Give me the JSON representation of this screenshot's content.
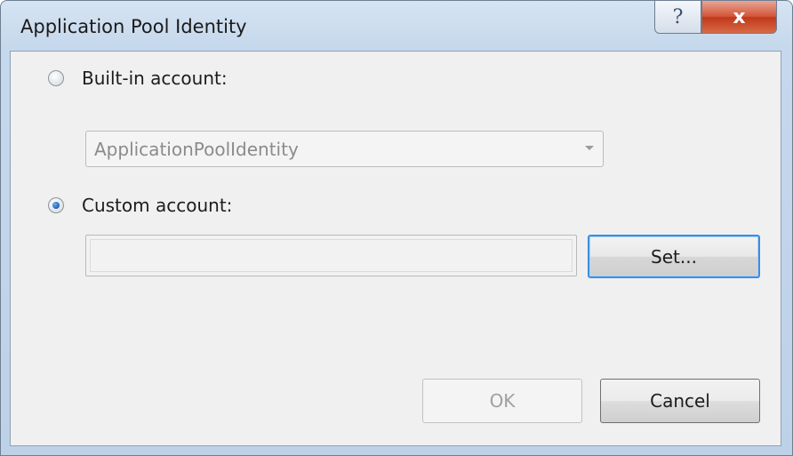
{
  "dialog": {
    "title": "Application Pool Identity",
    "help_glyph": "?",
    "close_glyph": "x"
  },
  "identity": {
    "builtin_label": "Built-in account:",
    "builtin_selected_value": "ApplicationPoolIdentity",
    "custom_label": "Custom account:",
    "custom_value": "",
    "selected_option": "custom",
    "set_label": "Set..."
  },
  "footer": {
    "ok_label": "OK",
    "cancel_label": "Cancel"
  },
  "colors": {
    "frame": "#c6d8ec",
    "close_button": "#c8452a",
    "focus_border": "#3c8ee0",
    "radio_dot": "#1d5fb6"
  },
  "icons": {
    "help": "help-icon",
    "close": "close-icon",
    "dropdown": "chevron-down-icon"
  }
}
